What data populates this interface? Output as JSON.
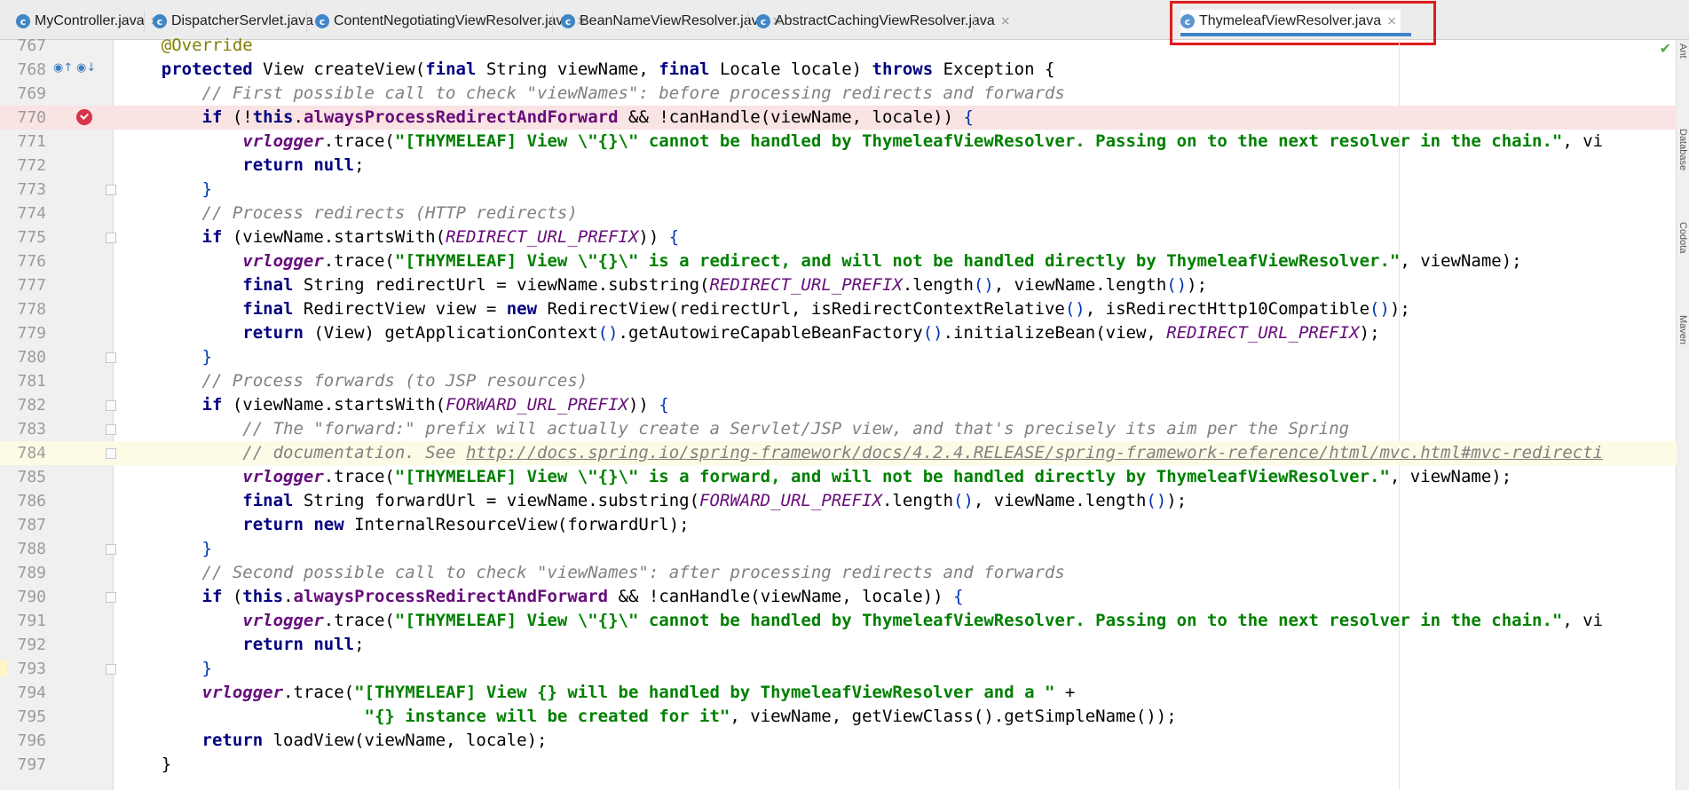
{
  "tabs": [
    {
      "label": "MyController.java",
      "active": false
    },
    {
      "label": "DispatcherServlet.java",
      "active": false
    },
    {
      "label": "ContentNegotiatingViewResolver.java",
      "active": false
    },
    {
      "label": "BeanNameViewResolver.java",
      "active": false
    },
    {
      "label": "AbstractCachingViewResolver.java",
      "active": false
    },
    {
      "label": "ThymeleafViewResolver.java",
      "active": true
    }
  ],
  "tab_icon_letter": "c",
  "tab_close_glyph": "×",
  "right_panel": [
    "Ant",
    "Database",
    "Codota",
    "Maven"
  ],
  "colors": {
    "active_tab_underline": "#4083c9",
    "highlight_box": "#e01b1b",
    "breakpoint": "#d6344a",
    "keyword": "#000080",
    "string": "#008000",
    "comment": "#808080",
    "field": "#660e7a"
  },
  "code_lines": [
    {
      "n": "767",
      "text": "    @Override"
    },
    {
      "n": "768",
      "text": "    protected View createView(final String viewName, final Locale locale) throws Exception {"
    },
    {
      "n": "769",
      "text": "        // First possible call to check \"viewNames\": before processing redirects and forwards"
    },
    {
      "n": "770",
      "text": "        if (!this.alwaysProcessRedirectAndForward && !canHandle(viewName, locale)) {"
    },
    {
      "n": "771",
      "text": "            vrlogger.trace(\"[THYMELEAF] View \\\"{}\\\" cannot be handled by ThymeleafViewResolver. Passing on to the next resolver in the chain.\", vi"
    },
    {
      "n": "772",
      "text": "            return null;"
    },
    {
      "n": "773",
      "text": "        }"
    },
    {
      "n": "774",
      "text": "        // Process redirects (HTTP redirects)"
    },
    {
      "n": "775",
      "text": "        if (viewName.startsWith(REDIRECT_URL_PREFIX)) {"
    },
    {
      "n": "776",
      "text": "            vrlogger.trace(\"[THYMELEAF] View \\\"{}\\\" is a redirect, and will not be handled directly by ThymeleafViewResolver.\", viewName);"
    },
    {
      "n": "777",
      "text": "            final String redirectUrl = viewName.substring(REDIRECT_URL_PREFIX.length(), viewName.length());"
    },
    {
      "n": "778",
      "text": "            final RedirectView view = new RedirectView(redirectUrl, isRedirectContextRelative(), isRedirectHttp10Compatible());"
    },
    {
      "n": "779",
      "text": "            return (View) getApplicationContext().getAutowireCapableBeanFactory().initializeBean(view, REDIRECT_URL_PREFIX);"
    },
    {
      "n": "780",
      "text": "        }"
    },
    {
      "n": "781",
      "text": "        // Process forwards (to JSP resources)"
    },
    {
      "n": "782",
      "text": "        if (viewName.startsWith(FORWARD_URL_PREFIX)) {"
    },
    {
      "n": "783",
      "text": "            // The \"forward:\" prefix will actually create a Servlet/JSP view, and that's precisely its aim per the Spring"
    },
    {
      "n": "784",
      "text": "            // documentation. See http://docs.spring.io/spring-framework/docs/4.2.4.RELEASE/spring-framework-reference/html/mvc.html#mvc-redirecti"
    },
    {
      "n": "785",
      "text": "            vrlogger.trace(\"[THYMELEAF] View \\\"{}\\\" is a forward, and will not be handled directly by ThymeleafViewResolver.\", viewName);"
    },
    {
      "n": "786",
      "text": "            final String forwardUrl = viewName.substring(FORWARD_URL_PREFIX.length(), viewName.length());"
    },
    {
      "n": "787",
      "text": "            return new InternalResourceView(forwardUrl);"
    },
    {
      "n": "788",
      "text": "        }"
    },
    {
      "n": "789",
      "text": "        // Second possible call to check \"viewNames\": after processing redirects and forwards"
    },
    {
      "n": "790",
      "text": "        if (this.alwaysProcessRedirectAndForward && !canHandle(viewName, locale)) {"
    },
    {
      "n": "791",
      "text": "            vrlogger.trace(\"[THYMELEAF] View \\\"{}\\\" cannot be handled by ThymeleafViewResolver. Passing on to the next resolver in the chain.\", vi"
    },
    {
      "n": "792",
      "text": "            return null;"
    },
    {
      "n": "793",
      "text": "        }"
    },
    {
      "n": "794",
      "text": "        vrlogger.trace(\"[THYMELEAF] View {} will be handled by ThymeleafViewResolver and a \" +"
    },
    {
      "n": "795",
      "text": "                        \"{} instance will be created for it\", viewName, getViewClass().getSimpleName());"
    },
    {
      "n": "796",
      "text": "        return loadView(viewName, locale);"
    },
    {
      "n": "797",
      "text": "    }"
    }
  ]
}
